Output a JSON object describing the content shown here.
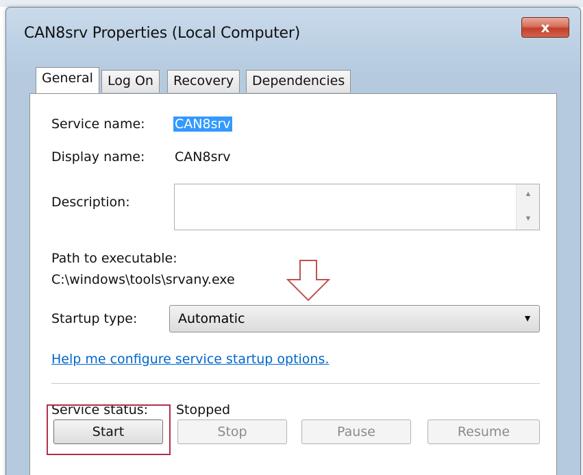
{
  "window": {
    "title": "CAN8srv Properties (Local Computer)",
    "close_label": "x"
  },
  "tabs": [
    {
      "label": "General",
      "active": true
    },
    {
      "label": "Log On",
      "active": false
    },
    {
      "label": "Recovery",
      "active": false
    },
    {
      "label": "Dependencies",
      "active": false
    }
  ],
  "general": {
    "service_name_label": "Service name:",
    "service_name_value": "CAN8srv",
    "display_name_label": "Display name:",
    "display_name_value": "CAN8srv",
    "description_label": "Description:",
    "description_value": "",
    "path_label": "Path to executable:",
    "path_value": "C:\\windows\\tools\\srvany.exe",
    "startup_type_label": "Startup type:",
    "startup_type_value": "Automatic",
    "help_link": "Help me configure service startup options.",
    "service_status_label": "Service status:",
    "service_status_value": "Stopped"
  },
  "buttons": {
    "start": "Start",
    "stop": "Stop",
    "pause": "Pause",
    "resume": "Resume"
  },
  "icons": {
    "annotation": "down-arrow-icon",
    "dropdown": "chevron-down-icon",
    "close": "close-icon"
  },
  "colors": {
    "highlight_border": "#b0304a",
    "link": "#0066cc",
    "selection": "#3399ff",
    "arrow_annotation": "#c0504d"
  }
}
